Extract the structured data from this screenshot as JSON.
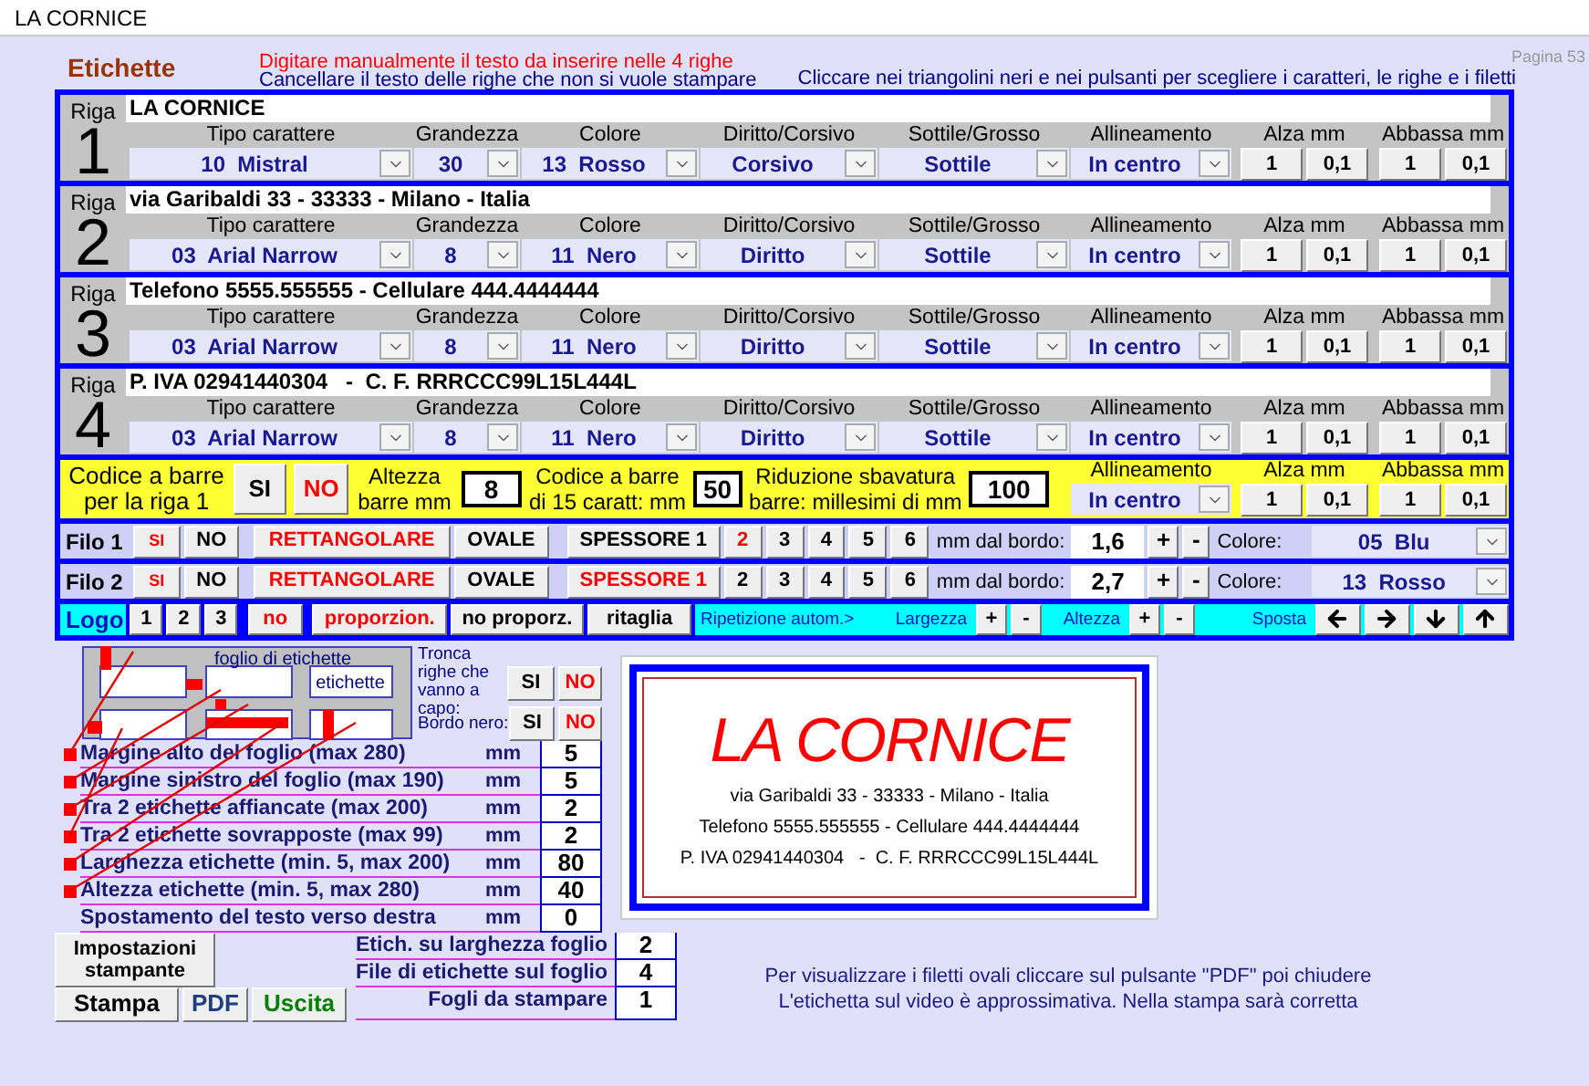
{
  "window": {
    "title": "LA CORNICE"
  },
  "header": {
    "title": "Etichette",
    "page": "Pagina 53",
    "hint": "Cliccare nei triangolini neri e nei pulsanti per scegliere i caratteri, le righe e i filetti",
    "instructions": [
      {
        "text": "Digitare manualmente il testo da inserire nelle 4 righe",
        "color": "#ff0000"
      },
      {
        "text": "Cancellare il testo delle righe che non si vuole stampare",
        "color": "#000080"
      }
    ]
  },
  "rows": [
    {
      "label": "Riga",
      "number": "1",
      "text": "LA CORNICE",
      "fields": [
        {
          "kind": "select",
          "label": "Tipo carattere",
          "value": "10  Mistral"
        },
        {
          "kind": "select",
          "label": "Grandezza",
          "value": "30"
        },
        {
          "kind": "select",
          "label": "Colore",
          "value": "13  Rosso"
        },
        {
          "kind": "select",
          "label": "Diritto/Corsivo",
          "value": "Corsivo"
        },
        {
          "kind": "select",
          "label": "Sottile/Grosso",
          "value": "Sottile"
        },
        {
          "kind": "select",
          "label": "Allineamento",
          "value": "In centro"
        },
        {
          "kind": "buttons",
          "label": "Alza mm",
          "buttons": [
            "1",
            "0,1"
          ]
        },
        {
          "kind": "buttons",
          "label": "Abbassa mm",
          "buttons": [
            "1",
            "0,1"
          ]
        }
      ]
    },
    {
      "label": "Riga",
      "number": "2",
      "text": "via Garibaldi 33 - 33333 - Milano - Italia",
      "fields": [
        {
          "kind": "select",
          "label": "Tipo carattere",
          "value": "03  Arial Narrow"
        },
        {
          "kind": "select",
          "label": "Grandezza",
          "value": "8"
        },
        {
          "kind": "select",
          "label": "Colore",
          "value": "11  Nero"
        },
        {
          "kind": "select",
          "label": "Diritto/Corsivo",
          "value": "Diritto"
        },
        {
          "kind": "select",
          "label": "Sottile/Grosso",
          "value": "Sottile"
        },
        {
          "kind": "select",
          "label": "Allineamento",
          "value": "In centro"
        },
        {
          "kind": "buttons",
          "label": "Alza mm",
          "buttons": [
            "1",
            "0,1"
          ]
        },
        {
          "kind": "buttons",
          "label": "Abbassa mm",
          "buttons": [
            "1",
            "0,1"
          ]
        }
      ]
    },
    {
      "label": "Riga",
      "number": "3",
      "text": "Telefono 5555.555555 - Cellulare 444.4444444",
      "fields": [
        {
          "kind": "select",
          "label": "Tipo carattere",
          "value": "03  Arial Narrow"
        },
        {
          "kind": "select",
          "label": "Grandezza",
          "value": "8"
        },
        {
          "kind": "select",
          "label": "Colore",
          "value": "11  Nero"
        },
        {
          "kind": "select",
          "label": "Diritto/Corsivo",
          "value": "Diritto"
        },
        {
          "kind": "select",
          "label": "Sottile/Grosso",
          "value": "Sottile"
        },
        {
          "kind": "select",
          "label": "Allineamento",
          "value": "In centro"
        },
        {
          "kind": "buttons",
          "label": "Alza mm",
          "buttons": [
            "1",
            "0,1"
          ]
        },
        {
          "kind": "buttons",
          "label": "Abbassa mm",
          "buttons": [
            "1",
            "0,1"
          ]
        }
      ]
    },
    {
      "label": "Riga",
      "number": "4",
      "text": "P. IVA 02941440304   -  C. F. RRRCCC99L15L444L",
      "fields": [
        {
          "kind": "select",
          "label": "Tipo carattere",
          "value": "03  Arial Narrow"
        },
        {
          "kind": "select",
          "label": "Grandezza",
          "value": "8"
        },
        {
          "kind": "select",
          "label": "Colore",
          "value": "11  Nero"
        },
        {
          "kind": "select",
          "label": "Diritto/Corsivo",
          "value": "Diritto"
        },
        {
          "kind": "select",
          "label": "Sottile/Grosso",
          "value": "Sottile"
        },
        {
          "kind": "select",
          "label": "Allineamento",
          "value": "In centro"
        },
        {
          "kind": "buttons",
          "label": "Alza mm",
          "buttons": [
            "1",
            "0,1"
          ]
        },
        {
          "kind": "buttons",
          "label": "Abbassa mm",
          "buttons": [
            "1",
            "0,1"
          ]
        }
      ]
    }
  ],
  "barcode": {
    "label": "Codice a barre\nper la riga 1",
    "choices": [
      {
        "label": "SI",
        "selected": false
      },
      {
        "label": "NO",
        "selected": true
      }
    ],
    "inputs": [
      {
        "label": "Altezza\nbarre mm",
        "value": "8"
      },
      {
        "label": "Codice a barre\ndi 15 caratt: mm",
        "value": "50"
      },
      {
        "label": "Riduzione sbavatura\nbarre: millesimi di mm",
        "value": "100"
      }
    ],
    "fields": [
      {
        "kind": "select",
        "label": "Allineamento",
        "value": "In centro"
      },
      {
        "kind": "buttons",
        "label": "Alza mm",
        "buttons": [
          "1",
          "0,1"
        ]
      },
      {
        "kind": "buttons",
        "label": "Abbassa mm",
        "buttons": [
          "1",
          "0,1"
        ]
      }
    ]
  },
  "threads": [
    {
      "label": "Filo 1",
      "switch": [
        {
          "label": "SI",
          "selected": true
        },
        {
          "label": "NO",
          "selected": false
        }
      ],
      "shape": [
        {
          "label": "RETTANGOLARE",
          "selected": true
        },
        {
          "label": "OVALE",
          "selected": false
        }
      ],
      "thickness": [
        {
          "label": "SPESSORE 1",
          "selected": false
        },
        {
          "label": "2",
          "selected": true
        },
        {
          "label": "3",
          "selected": false
        },
        {
          "label": "4",
          "selected": false
        },
        {
          "label": "5",
          "selected": false
        },
        {
          "label": "6",
          "selected": false
        }
      ],
      "distance_label": "mm dal bordo:",
      "distance": "1,6",
      "plus": "+",
      "minus": "-",
      "color_label": "Colore:",
      "color_value": "05  Blu"
    },
    {
      "label": "Filo 2",
      "switch": [
        {
          "label": "SI",
          "selected": true
        },
        {
          "label": "NO",
          "selected": false
        }
      ],
      "shape": [
        {
          "label": "RETTANGOLARE",
          "selected": true
        },
        {
          "label": "OVALE",
          "selected": false
        }
      ],
      "thickness": [
        {
          "label": "SPESSORE 1",
          "selected": true
        },
        {
          "label": "2",
          "selected": false
        },
        {
          "label": "3",
          "selected": false
        },
        {
          "label": "4",
          "selected": false
        },
        {
          "label": "5",
          "selected": false
        },
        {
          "label": "6",
          "selected": false
        }
      ],
      "distance_label": "mm dal bordo:",
      "distance": "2,7",
      "plus": "+",
      "minus": "-",
      "color_label": "Colore:",
      "color_value": "13  Rosso"
    }
  ],
  "logo": {
    "label": "Logo",
    "numbers": [
      {
        "label": "1",
        "selected": false
      },
      {
        "label": "2",
        "selected": false
      },
      {
        "label": "3",
        "selected": false
      }
    ],
    "none": {
      "label": "no",
      "selected": true
    },
    "modes": [
      {
        "label": "proporzion.",
        "selected": true
      },
      {
        "label": "no proporz.",
        "selected": false
      },
      {
        "label": "ritaglia",
        "selected": false
      }
    ],
    "repeat_label": "Ripetizione autom.>",
    "sizes": [
      {
        "label": "Largezza",
        "buttons": [
          "+",
          "-"
        ]
      },
      {
        "label": "Altezza",
        "buttons": [
          "+",
          "-"
        ]
      }
    ],
    "move_label": "Sposta"
  },
  "sheet": {
    "title": "foglio di etichette",
    "label": "etichette"
  },
  "options": [
    {
      "label": "Tronca righe che vanno a capo:",
      "choices": [
        {
          "label": "SI",
          "selected": false
        },
        {
          "label": "NO",
          "selected": true
        }
      ]
    },
    {
      "label": "Bordo nero:",
      "choices": [
        {
          "label": "SI",
          "selected": false
        },
        {
          "label": "NO",
          "selected": true
        }
      ]
    }
  ],
  "settings": [
    {
      "label": "Margine alto del foglio (max 280)",
      "unit": "mm",
      "value": "5",
      "marker": true
    },
    {
      "label": "Margine sinistro del foglio (max 190)",
      "unit": "mm",
      "value": "5",
      "marker": true
    },
    {
      "label": "Tra 2 etichette affiancate (max 200)",
      "unit": "mm",
      "value": "2",
      "marker": true
    },
    {
      "label": "Tra 2 etichette sovrapposte (max 99)",
      "unit": "mm",
      "value": "2",
      "marker": true
    },
    {
      "label": "Larghezza etichette (min. 5, max 200)",
      "unit": "mm",
      "value": "80",
      "marker": true
    },
    {
      "label": "Altezza etichette (min. 5, max 280)",
      "unit": "mm",
      "value": "40",
      "marker": true
    },
    {
      "label": "Spostamento del testo verso destra",
      "unit": "mm",
      "value": "0",
      "marker": false
    }
  ],
  "sheet_settings": [
    {
      "label": "Etich. su larghezza foglio",
      "value": "2"
    },
    {
      "label": "File di etichette sul foglio",
      "value": "4"
    },
    {
      "label": "Fogli da stampare",
      "value": "1"
    }
  ],
  "setup_button": "Impostazioni\nstampante",
  "actions": [
    {
      "label": "Stampa",
      "color": "#000000"
    },
    {
      "label": "PDF",
      "color": "#1f3f7f"
    },
    {
      "label": "Uscita",
      "color": "#008000"
    }
  ],
  "preview": {
    "lines": [
      {
        "kind": "title",
        "text": "LA CORNICE"
      },
      {
        "kind": "line",
        "text": "via Garibaldi 33 - 33333 - Milano - Italia"
      },
      {
        "kind": "line",
        "text": "Telefono 5555.555555 - Cellulare 444.4444444"
      },
      {
        "kind": "line",
        "text": "P. IVA 02941440304   -  C. F. RRRCCC99L15L444L"
      }
    ]
  },
  "notes": [
    "Per visualizzare i filetti ovali cliccare sul pulsante \"PDF\" poi chiudere",
    "L'etichetta sul video è approssimativa. Nella stampa sarà corretta"
  ]
}
